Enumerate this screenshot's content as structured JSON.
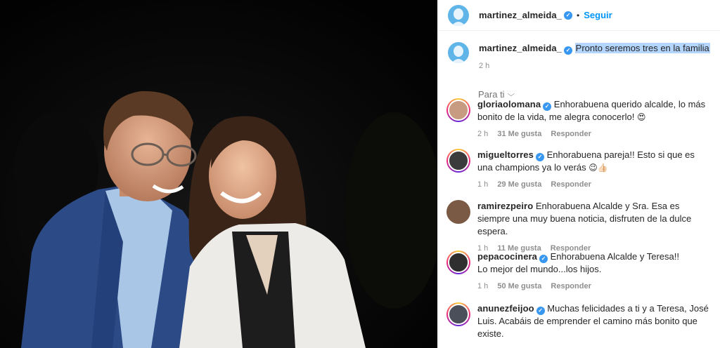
{
  "post": {
    "author": "martinez_almeida_",
    "follow_label": "Seguir",
    "dot": "•",
    "caption": "Pronto seremos tres en la familia",
    "caption_time": "2 h",
    "sort_label": "Para ti",
    "sort_icon": "chevron-down-icon"
  },
  "comments": [
    {
      "user": "gloriaolomana",
      "text": "Enhorabuena querido alcalde, lo más bonito de la vida, me alegra conocerlo!",
      "emoji": "😍",
      "time": "2 h",
      "likes": "31 Me gusta",
      "reply": "Responder",
      "verified": true
    },
    {
      "user": "migueltorres",
      "text": "Enhorabuena pareja!! Esto si que es una champions ya lo verás",
      "emoji": "😉👍🏻",
      "time": "1 h",
      "likes": "29 Me gusta",
      "reply": "Responder",
      "verified": true
    },
    {
      "user": "ramirezpeiro",
      "text": "Enhorabuena Alcalde y Sra. Esa es siempre una muy buena noticia, disfruten de la dulce espera.",
      "time": "1 h",
      "likes": "11 Me gusta",
      "reply": "Responder",
      "verified": false
    },
    {
      "user": "pepacocinera",
      "text": "Enhorabuena Alcalde y Teresa!!",
      "text2": "Lo mejor del mundo...los hijos.",
      "time": "1 h",
      "likes": "50 Me gusta",
      "reply": "Responder",
      "verified": true
    },
    {
      "user": "anunezfeijoo",
      "text": "Muchas felicidades a ti y a Teresa, José Luis. Acabáis de emprender el camino más bonito que existe.",
      "verified": true
    }
  ],
  "colors": {
    "link_blue": "#0095f6",
    "verified_blue": "#3897f0",
    "highlight": "#b4d5fe",
    "muted": "#8e8e8e"
  }
}
